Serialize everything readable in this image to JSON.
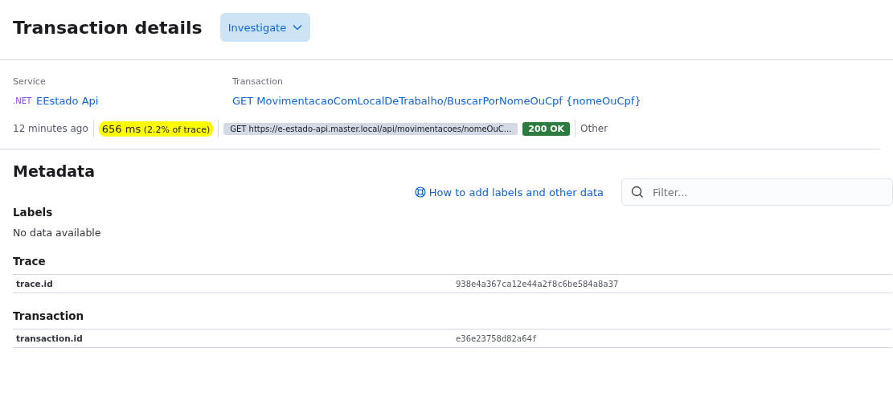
{
  "header": {
    "title": "Transaction details",
    "investigate_button": "Investigate"
  },
  "summary": {
    "service_label": "Service",
    "service_agent": ".NET",
    "service_name": "EEstado Api",
    "transaction_label": "Transaction",
    "transaction_name": "GET MovimentacaoComLocalDeTrabalho/BuscarPorNomeOuCpf {nomeOuCpf}"
  },
  "meta_row": {
    "time": "12 minutes ago",
    "duration": "656 ms",
    "duration_share": "(2.2% of trace)",
    "highlighted": true,
    "url": "GET https://e-estado-api.master.local/api/movimentacoes/nomeOuC...",
    "status": "200 OK",
    "type": "Other"
  },
  "metadata": {
    "title": "Metadata",
    "help_link": "How to add labels and other data",
    "filter_placeholder": "Filter...",
    "sections": [
      {
        "title": "Labels",
        "empty_text": "No data available"
      },
      {
        "title": "Trace",
        "rows": [
          {
            "key": "trace.id",
            "value": "938e4a367ca12e44a2f8c6be584a8a37"
          }
        ]
      },
      {
        "title": "Transaction",
        "rows": [
          {
            "key": "transaction.id",
            "value": "e36e23758d82a64f"
          }
        ]
      }
    ]
  }
}
